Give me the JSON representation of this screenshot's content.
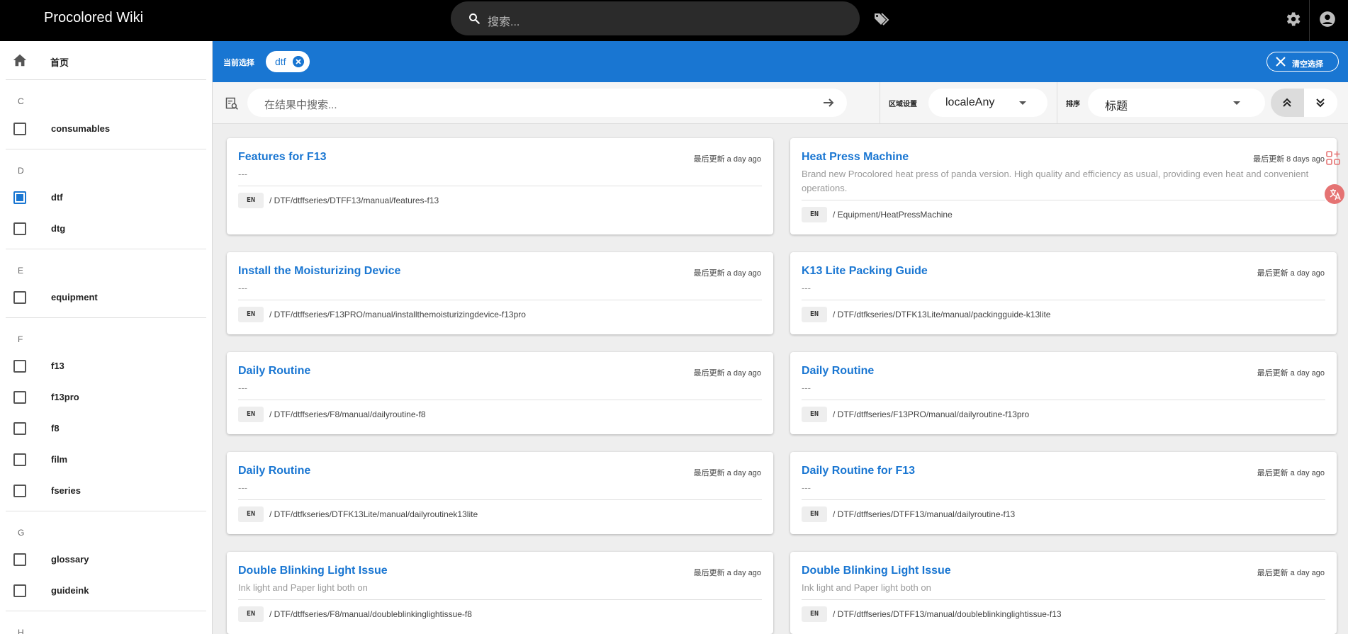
{
  "header": {
    "brand": "Procolored Wiki",
    "search_placeholder": "搜索..."
  },
  "sidebar": {
    "home_label": "首页",
    "groups": [
      {
        "letter": "C",
        "items": [
          {
            "label": "consumables",
            "checked": false
          }
        ]
      },
      {
        "letter": "D",
        "items": [
          {
            "label": "dtf",
            "checked": true
          },
          {
            "label": "dtg",
            "checked": false
          }
        ]
      },
      {
        "letter": "E",
        "items": [
          {
            "label": "equipment",
            "checked": false
          }
        ]
      },
      {
        "letter": "F",
        "items": [
          {
            "label": "f13",
            "checked": false
          },
          {
            "label": "f13pro",
            "checked": false
          },
          {
            "label": "f8",
            "checked": false
          },
          {
            "label": "film",
            "checked": false
          },
          {
            "label": "fseries",
            "checked": false
          }
        ]
      },
      {
        "letter": "G",
        "items": [
          {
            "label": "glossary",
            "checked": false
          },
          {
            "label": "guideink",
            "checked": false
          }
        ]
      },
      {
        "letter": "H",
        "items": []
      }
    ]
  },
  "selection": {
    "current_label": "当前选择",
    "chip": "dtf",
    "clear_label": "清空选择"
  },
  "filters": {
    "search_placeholder": "在结果中搜索...",
    "locale_label": "区域设置",
    "locale_value": "localeAny",
    "sort_label": "排序",
    "sort_value": "标题"
  },
  "results": [
    {
      "title": "Features for F13",
      "updated": "最后更新 a day ago",
      "description": "---",
      "locale": "EN",
      "path": "/ DTF/dtffseries/DTFF13/manual/features-f13"
    },
    {
      "title": "Heat Press Machine",
      "updated": "最后更新 8 days ago",
      "description": "Brand new Procolored heat press of panda version. High quality and efficiency as usual, providing even heat and convenient operations.",
      "locale": "EN",
      "path": "/ Equipment/HeatPressMachine"
    },
    {
      "title": "Install the Moisturizing Device",
      "updated": "最后更新 a day ago",
      "description": "---",
      "locale": "EN",
      "path": "/ DTF/dtffseries/F13PRO/manual/installthemoisturizingdevice-f13pro"
    },
    {
      "title": "K13 Lite Packing Guide",
      "updated": "最后更新 a day ago",
      "description": "---",
      "locale": "EN",
      "path": "/ DTF/dtfkseries/DTFK13Lite/manual/packingguide-k13lite"
    },
    {
      "title": "Daily Routine",
      "updated": "最后更新 a day ago",
      "description": "---",
      "locale": "EN",
      "path": "/ DTF/dtffseries/F8/manual/dailyroutine-f8"
    },
    {
      "title": "Daily Routine",
      "updated": "最后更新 a day ago",
      "description": "---",
      "locale": "EN",
      "path": "/ DTF/dtffseries/F13PRO/manual/dailyroutine-f13pro"
    },
    {
      "title": "Daily Routine",
      "updated": "最后更新 a day ago",
      "description": "---",
      "locale": "EN",
      "path": "/ DTF/dtfkseries/DTFK13Lite/manual/dailyroutinek13lite"
    },
    {
      "title": "Daily Routine for F13",
      "updated": "最后更新 a day ago",
      "description": "---",
      "locale": "EN",
      "path": "/ DTF/dtffseries/DTFF13/manual/dailyroutine-f13"
    },
    {
      "title": "Double Blinking Light Issue",
      "updated": "最后更新 a day ago",
      "description": "Ink light and Paper light both on",
      "locale": "EN",
      "path": "/ DTF/dtffseries/F8/manual/doubleblinkinglightissue-f8"
    },
    {
      "title": "Double Blinking Light Issue",
      "updated": "最后更新 a day ago",
      "description": "Ink light and Paper light both on",
      "locale": "EN",
      "path": "/ DTF/dtffseries/DTFF13/manual/doubleblinkinglightissue-f13"
    }
  ],
  "colors": {
    "accent": "#1976d2",
    "topbar": "#000000"
  }
}
